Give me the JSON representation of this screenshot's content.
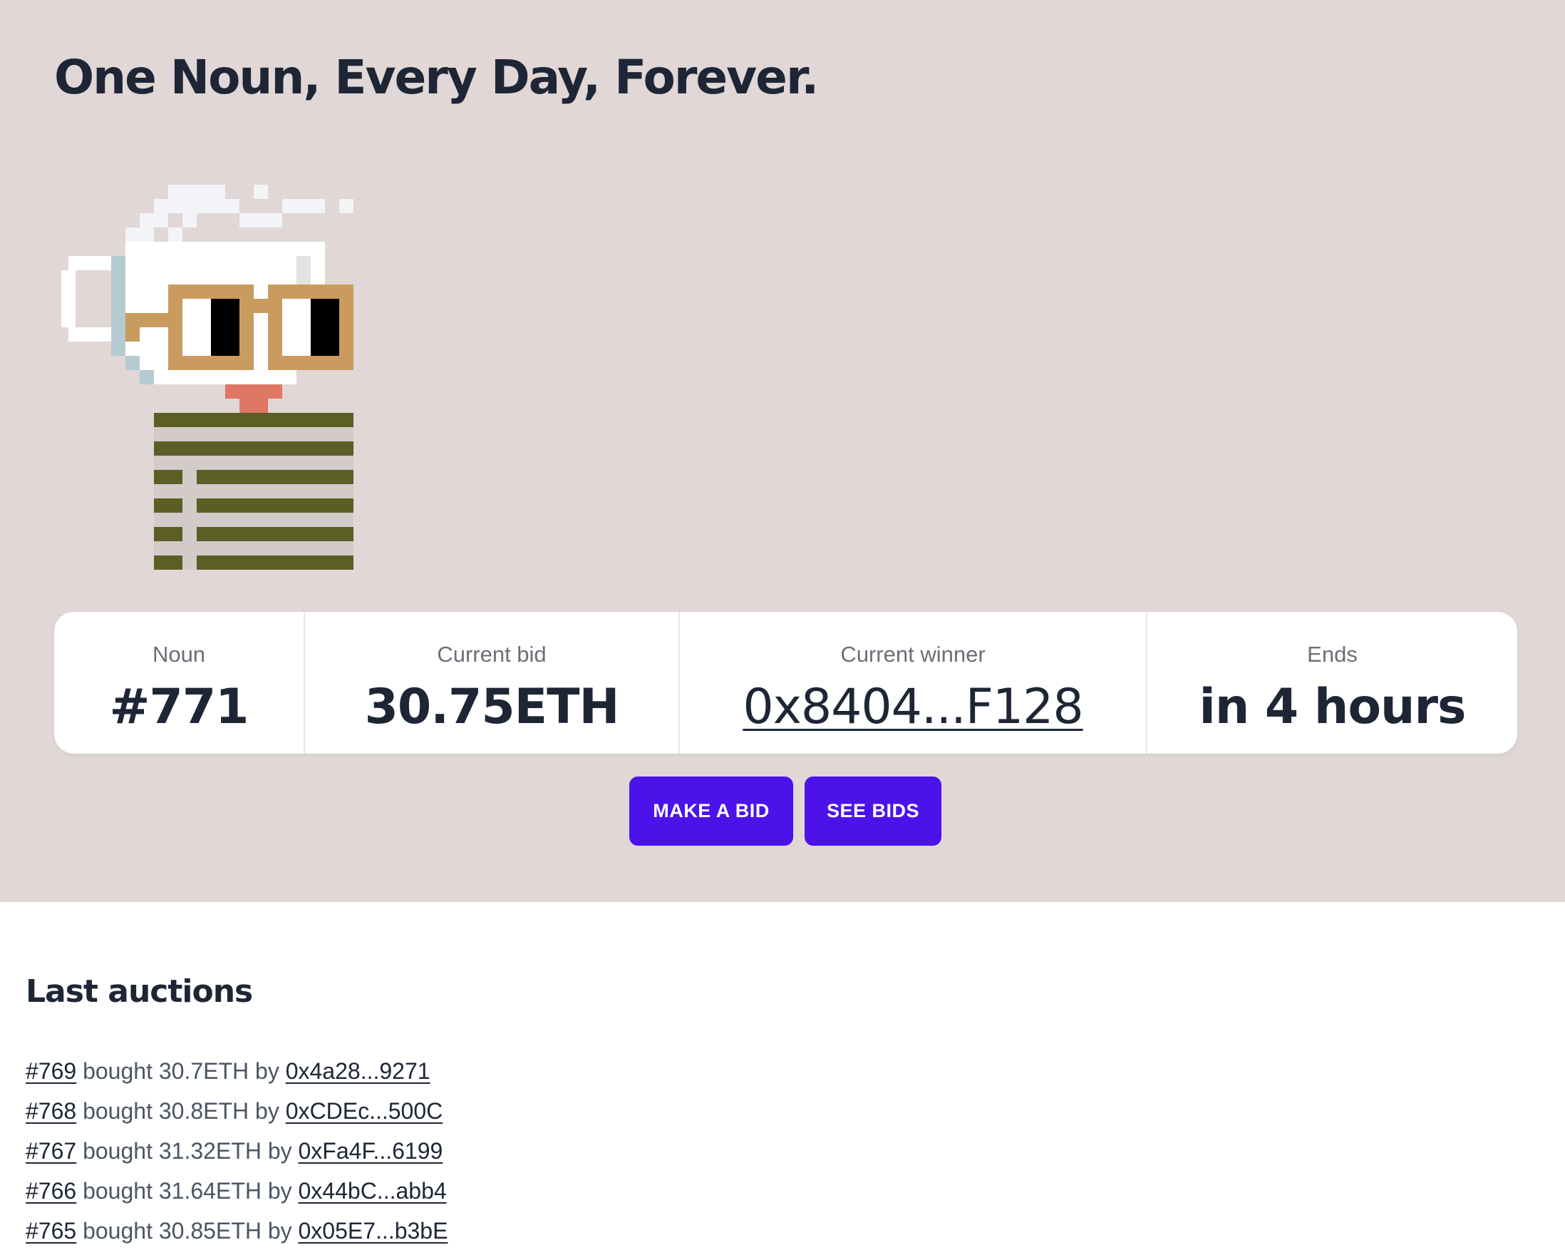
{
  "hero": {
    "title": "One Noun, Every Day, Forever.",
    "background": "#e0d7d6"
  },
  "noun_image": {
    "icon": "pixel-noun-coffee-mug-head-glasses-striped-shirt",
    "colors": {
      "steam": "#f2f4f7",
      "mug": "#ffffff",
      "mug_shadow": "#e2e4df",
      "mug_highlight": "#b5cad0",
      "glasses": "#c99b5f",
      "eye_white": "#ffffff",
      "pupil": "#000000",
      "tongue": "#df7765",
      "shirt_stripe": "#5a5f26",
      "shirt_light": "#d3cbc9"
    }
  },
  "auction": {
    "noun": {
      "label": "Noun",
      "value": "#771"
    },
    "current_bid": {
      "label": "Current bid",
      "value": "30.75ETH"
    },
    "current_winner": {
      "label": "Current winner",
      "value": "0x8404...F128"
    },
    "ends": {
      "label": "Ends",
      "value": "in 4 hours"
    }
  },
  "actions": {
    "make_bid_label": "MAKE A BID",
    "see_bids_label": "SEE BIDS",
    "button_color": "#4b12ea"
  },
  "last_auctions": {
    "title": "Last auctions",
    "items": [
      {
        "noun": "#769",
        "text": "bought 30.7ETH by",
        "buyer": "0x4a28...9271"
      },
      {
        "noun": "#768",
        "text": "bought 30.8ETH by",
        "buyer": "0xCDEc...500C"
      },
      {
        "noun": "#767",
        "text": "bought 31.32ETH by",
        "buyer": "0xFa4F...6199"
      },
      {
        "noun": "#766",
        "text": "bought 31.64ETH by",
        "buyer": "0x44bC...abb4"
      },
      {
        "noun": "#765",
        "text": "bought 30.85ETH by",
        "buyer": "0x05E7...b3bE"
      }
    ]
  }
}
